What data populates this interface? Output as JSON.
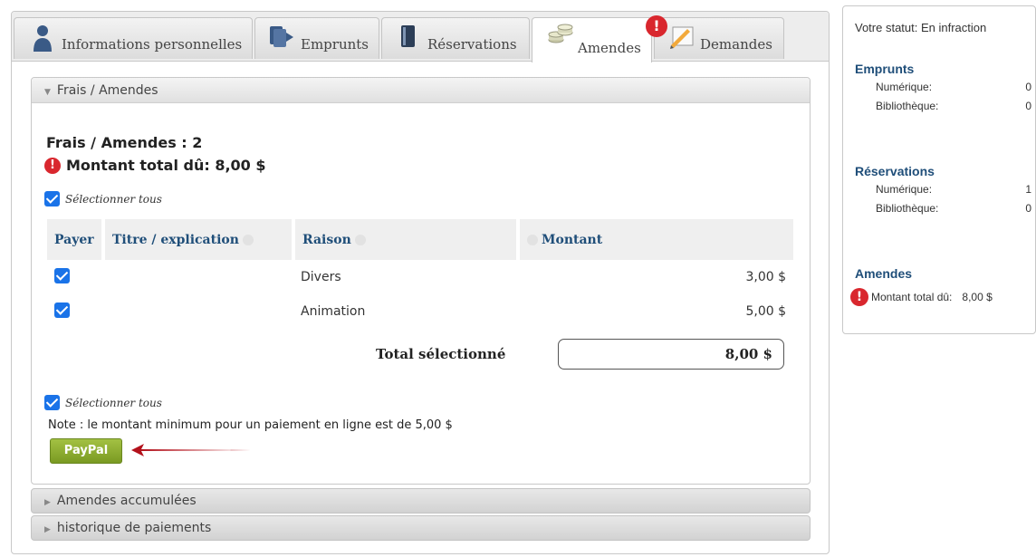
{
  "tabs": [
    {
      "label": "Informations personnelles",
      "icon": "person-icon",
      "active": false
    },
    {
      "label": "Emprunts",
      "icon": "books-icon",
      "active": false
    },
    {
      "label": "Réservations",
      "icon": "book-icon",
      "active": false
    },
    {
      "label": "Amendes",
      "icon": "coins-icon",
      "active": true,
      "alert": "!"
    },
    {
      "label": "Demandes",
      "icon": "pencil-icon",
      "active": false
    }
  ],
  "fees_section": {
    "title": "Frais / Amendes",
    "heading": "Frais / Amendes : 2",
    "total_due": "Montant total dû: 8,00 $",
    "select_all_label": "Sélectionner tous",
    "table": {
      "headers": {
        "pay": "Payer",
        "title": "Titre / explication",
        "reason": "Raison",
        "amount": "Montant"
      },
      "rows": [
        {
          "title": "",
          "reason": "Divers",
          "amount": "3,00 $",
          "checked": true
        },
        {
          "title": "",
          "reason": "Animation",
          "amount": "5,00 $",
          "checked": true
        }
      ]
    },
    "total_selected_label": "Total sélectionné",
    "total_selected_value": "8,00 $",
    "note": "Note : le montant minimum pour un paiement en ligne est de 5,00 $",
    "paypal_label": "PayPal"
  },
  "collapsed_sections": [
    "Amendes accumulées",
    "historique de paiements"
  ],
  "status_panel": {
    "status": "Votre statut: En infraction",
    "loans": {
      "title": "Emprunts",
      "digital_label": "Numérique:",
      "digital_value": "0",
      "library_label": "Bibliothèque:",
      "library_value": "0"
    },
    "reservations": {
      "title": "Réservations",
      "digital_label": "Numérique:",
      "digital_value": "1",
      "library_label": "Bibliothèque:",
      "library_value": "0"
    },
    "fines": {
      "title": "Amendes",
      "total_label": "Montant total dû:",
      "total_value": "8,00 $"
    }
  },
  "colors": {
    "accent_blue": "#1f4e79",
    "alert_red": "#d9272e",
    "checkbox_blue": "#1a73e8",
    "paypal_green": "#8bab2d"
  }
}
